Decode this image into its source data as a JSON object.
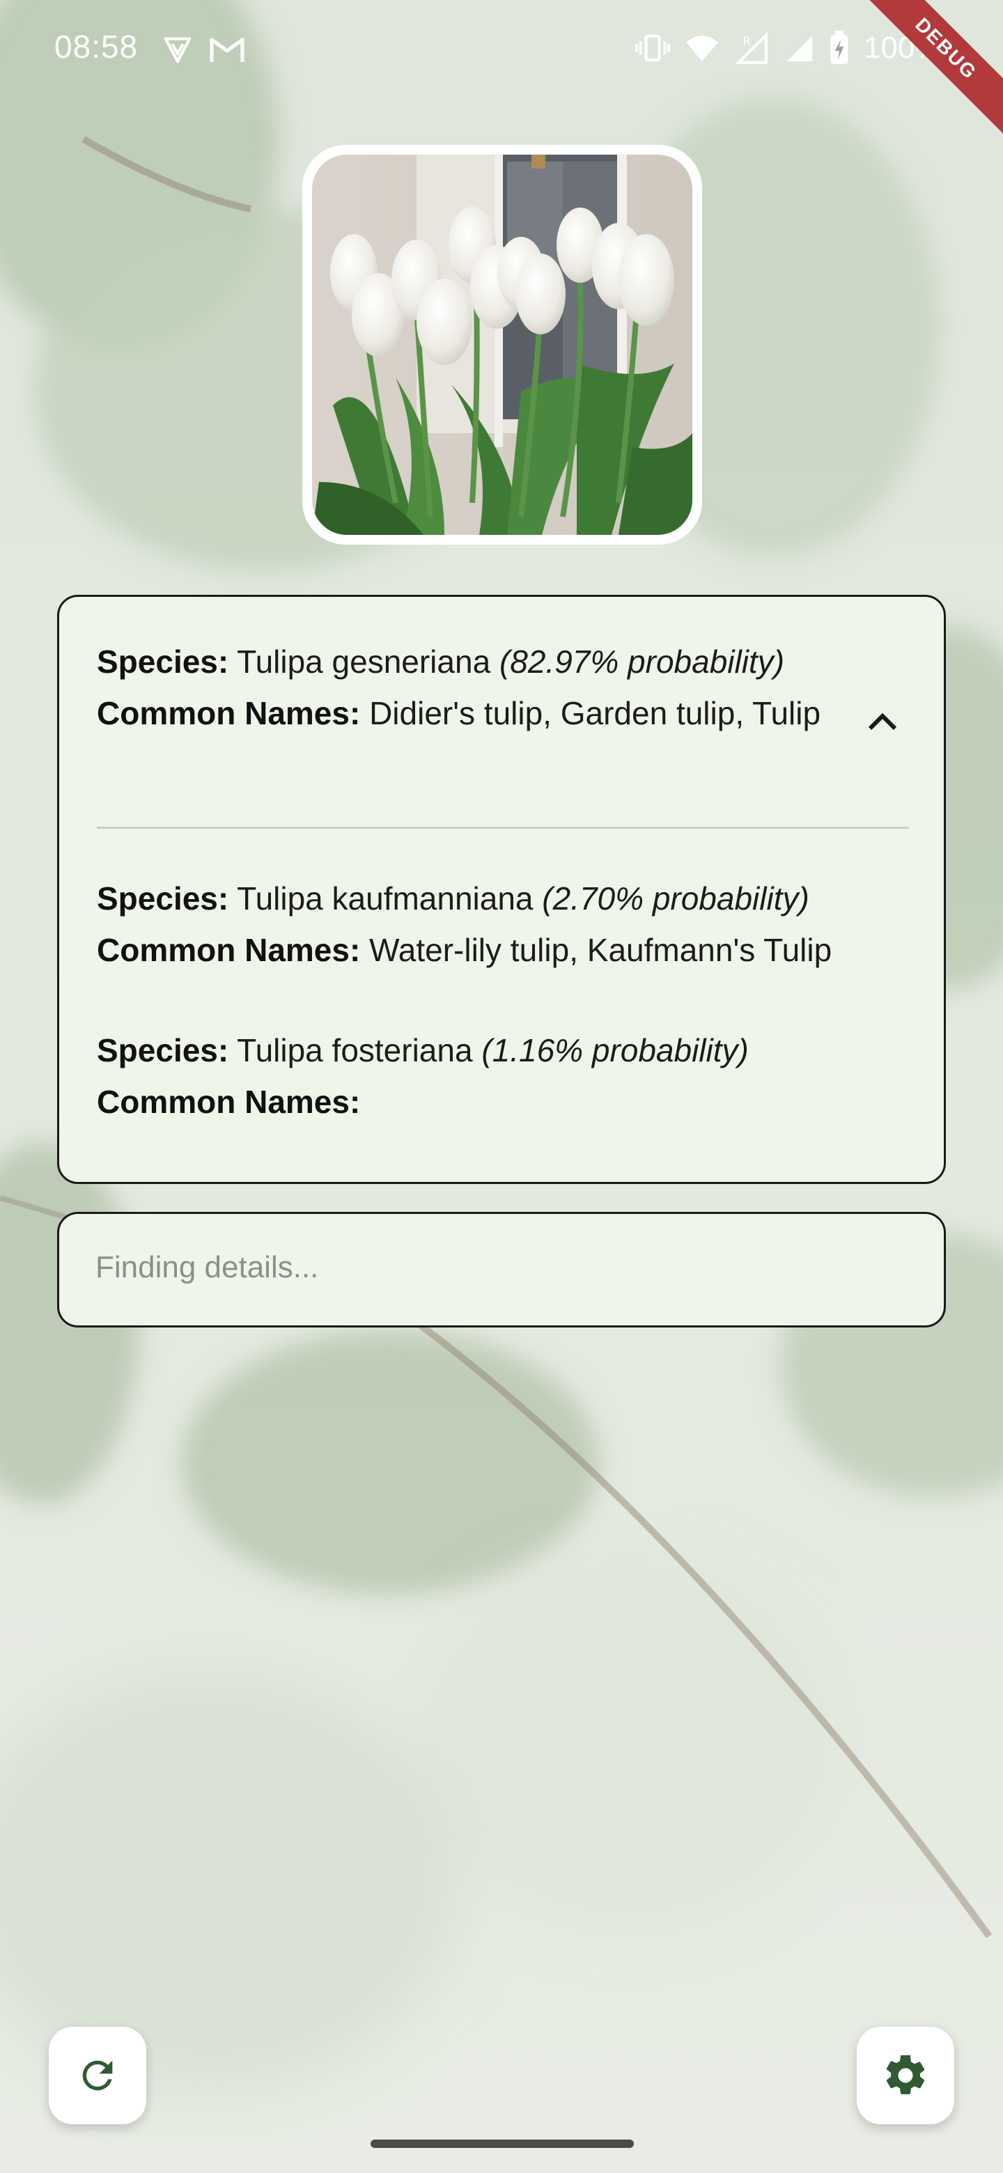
{
  "status_bar": {
    "time": "08:58",
    "left_icons": [
      "shield-v-icon",
      "gmail-icon"
    ],
    "right_icons": [
      "vibrate-icon",
      "wifi-icon",
      "signal-roaming-icon",
      "signal-icon",
      "battery-charging-icon"
    ],
    "battery": "100%"
  },
  "debug_banner": "DEBUG",
  "photo": {
    "subject": "white tulips bouquet"
  },
  "results": {
    "species_label": "Species:",
    "common_names_label": "Common Names:",
    "items": [
      {
        "species": "Tulipa gesneriana",
        "probability": "(82.97% probability)",
        "common_names": "Didier's tulip, Garden tulip, Tulip"
      },
      {
        "species": "Tulipa kaufmanniana",
        "probability": "(2.70% probability)",
        "common_names": "Water-lily tulip, Kaufmann's Tulip"
      },
      {
        "species": "Tulipa fosteriana",
        "probability": "(1.16% probability)",
        "common_names": ""
      }
    ],
    "expand_icon": "chevron-up-icon"
  },
  "details": {
    "placeholder": "Finding details..."
  },
  "buttons": {
    "refresh_icon": "refresh-icon",
    "settings_icon": "gear-icon"
  },
  "colors": {
    "card_background": "#f0f5e9",
    "card_border": "#1a1a1a",
    "accent_green": "#2f5a34",
    "debug_banner": "#b23a3a"
  }
}
